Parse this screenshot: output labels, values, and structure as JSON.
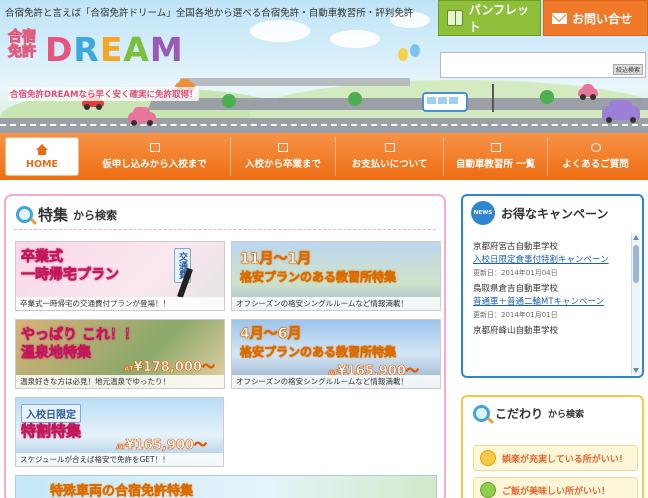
{
  "header": {
    "tagline": "合宿免許と言えば「合宿免許ドリーム」全国各地から選べる合宿免許・自動車教習所・評判免許",
    "logo_jp": "合宿免許",
    "logo_en": [
      "D",
      "R",
      "E",
      "A",
      "M"
    ],
    "logo_sub": "合宿免許DREAMなら早く安く確実に免許取得！",
    "pamphlet_label": "パンフレット",
    "inquiry_label": "お問い合せ",
    "search_button": "絞込検索"
  },
  "nav": {
    "items": [
      {
        "label": "HOME",
        "icon": "home-icon"
      },
      {
        "label": "仮申し込みから入校まで",
        "icon": "document-icon"
      },
      {
        "label": "入校から卒業まで",
        "icon": "document-icon"
      },
      {
        "label": "お支払いについて",
        "icon": "wallet-icon"
      },
      {
        "label": "自動車教習所 一覧",
        "icon": "building-icon"
      },
      {
        "label": "よくあるご質問",
        "icon": "question-icon"
      }
    ]
  },
  "feature_search": {
    "title_main": "特集",
    "title_rest": "から検索",
    "banners": [
      {
        "title_line1": "卒業式",
        "title_line2": "一時帰宅プラン",
        "sub": "卒業式一時帰宅の交通費付プランが登場！！",
        "tag": "交通費"
      },
      {
        "title_line1": "11月～1月",
        "title_line2": "格安プランのある教習所特集",
        "sub": "オフシーズンの格安シングルルームなど情報満載！"
      },
      {
        "title_line1": "やっぱり これ！！",
        "title_line2": "温泉地特集",
        "price": "¥178,000～",
        "price_prefix": "AT",
        "sub": "温泉好きな方は必見！地元温泉でゆったり！"
      },
      {
        "title_line1": "4月～6月",
        "title_line2": "格安プランのある教習所特集",
        "price": "¥165,900～",
        "price_prefix": "AT",
        "sub": "オフシーズンの格安シングルルームなど情報満載！"
      },
      {
        "title_line1": "入校日限定",
        "title_line2": "特割特集",
        "price": "¥165,900～",
        "price_prefix": "AT",
        "sub": "スケジュールが合えば格安で免許をGET！！"
      },
      {
        "title_line1": "特殊車両の合宿免許特集"
      }
    ]
  },
  "campaign": {
    "badge": "NEWS",
    "title": "お得なキャンペーン",
    "items": [
      {
        "school": "京都府宮古自動車学校",
        "link": "入校日限定食事付特割キャンペーン",
        "date": "更新日：2014年01月04日"
      },
      {
        "school": "鳥取県倉吉自動車学校",
        "link": "普通車＋普通二輪MTキャンペーン",
        "date": "更新日：2014年01月01日"
      },
      {
        "school": "京都府峰山自動車学校",
        "link": "",
        "date": ""
      }
    ]
  },
  "kodawari": {
    "title_main": "こだわり",
    "title_rest": "から検索",
    "items": [
      {
        "label": "娯楽が充実している所がいい！"
      },
      {
        "label": "ご飯が美味しい所がいい！"
      }
    ]
  }
}
